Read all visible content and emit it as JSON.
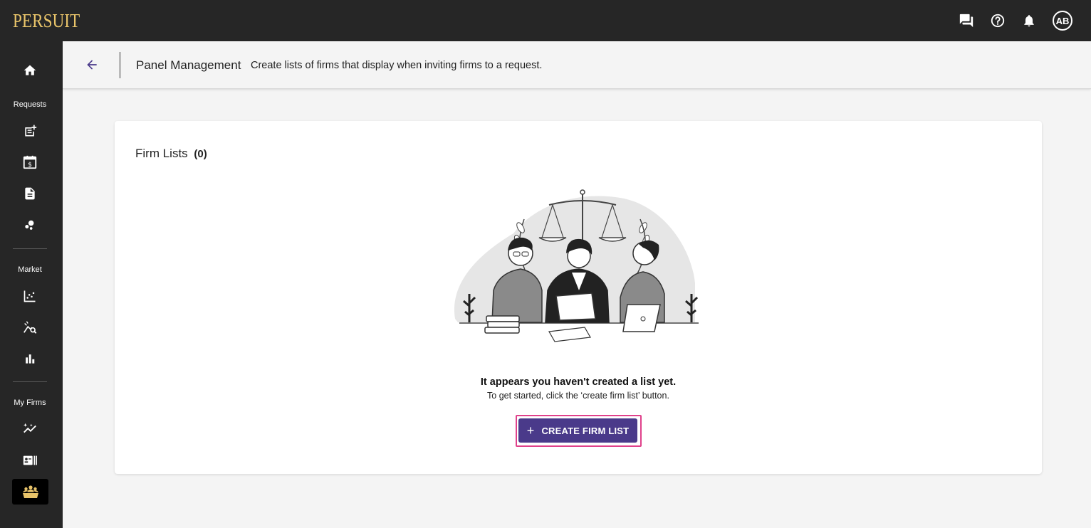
{
  "app": {
    "brand": "PERSUIT",
    "brand_color": "#e9c46a",
    "accent": "#4a3a8a",
    "highlight": "#e0418b"
  },
  "topbar": {
    "icons": [
      "chat-icon",
      "help-icon",
      "notifications-icon"
    ],
    "avatar_initials": "AB"
  },
  "sidebar": {
    "sections": [
      {
        "label": "Requests",
        "items": [
          "new-request-icon",
          "pricing-calendar-icon",
          "document-icon",
          "scatter-icon"
        ]
      },
      {
        "label": "Market",
        "items": [
          "market-chart-icon",
          "market-search-icon",
          "bar-chart-icon"
        ]
      },
      {
        "label": "My Firms",
        "items": [
          "firms-insights-icon",
          "firm-cards-icon",
          "panel-management-icon"
        ]
      }
    ],
    "home_icon": "home-icon",
    "active_item": "panel-management-icon"
  },
  "header": {
    "title": "Panel Management",
    "description": "Create lists of firms that display when inviting firms to a request."
  },
  "card": {
    "title": "Firm Lists",
    "count": "(0)",
    "empty_heading": "It appears you haven't created a list yet.",
    "empty_subtext": "To get started, click the ‘create firm list’ button.",
    "create_button_label": "CREATE FIRM LIST",
    "create_button_icon": "plus"
  }
}
